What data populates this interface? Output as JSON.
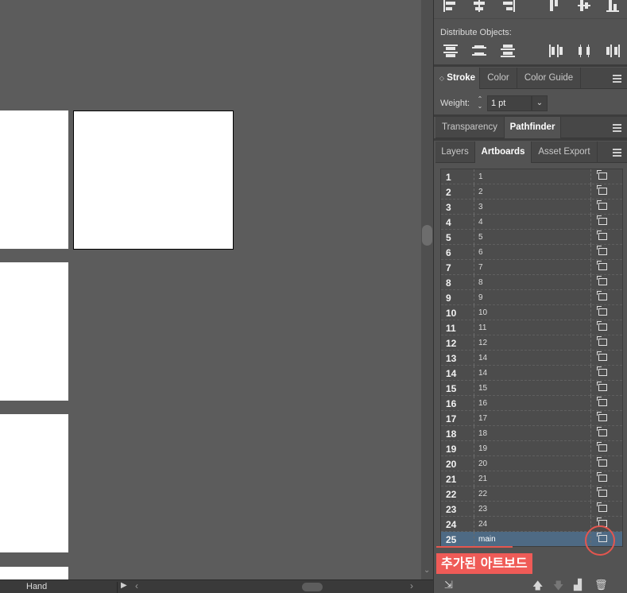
{
  "canvas": {
    "artboards": [
      "partial-1",
      "selected",
      "partial-2",
      "partial-3",
      "partial-4"
    ]
  },
  "status_bar": {
    "tool": "Hand",
    "play_icon": "play-icon",
    "left_arrow": "‹",
    "right_arrow": "›"
  },
  "panel": {
    "align_icons": [
      "align-left-icon",
      "align-hcenter-icon",
      "align-right-icon",
      "align-top-icon",
      "align-vcenter-icon",
      "align-bottom-icon"
    ],
    "distribute": {
      "label": "Distribute Objects:",
      "icons": [
        "distribute-top-icon",
        "distribute-vcenter-icon",
        "distribute-bottom-icon",
        "distribute-left-icon",
        "distribute-hcenter-icon",
        "distribute-right-icon"
      ]
    },
    "stroke_tabs": [
      "Stroke",
      "Color",
      "Color Guide"
    ],
    "stroke_tab_prefix": "◇",
    "weight": {
      "label": "Weight:",
      "value": "1 pt"
    },
    "transparency_tabs": [
      "Transparency",
      "Pathfinder"
    ],
    "artboard_tabs": [
      "Layers",
      "Artboards",
      "Asset Export"
    ],
    "artboards": [
      {
        "num": "1",
        "name": "1"
      },
      {
        "num": "2",
        "name": "2"
      },
      {
        "num": "3",
        "name": "3"
      },
      {
        "num": "4",
        "name": "4"
      },
      {
        "num": "5",
        "name": "5"
      },
      {
        "num": "6",
        "name": "6"
      },
      {
        "num": "7",
        "name": "7"
      },
      {
        "num": "8",
        "name": "8"
      },
      {
        "num": "9",
        "name": "9"
      },
      {
        "num": "10",
        "name": "10"
      },
      {
        "num": "11",
        "name": "11"
      },
      {
        "num": "12",
        "name": "12"
      },
      {
        "num": "13",
        "name": "14"
      },
      {
        "num": "14",
        "name": "14"
      },
      {
        "num": "15",
        "name": "15"
      },
      {
        "num": "16",
        "name": "16"
      },
      {
        "num": "17",
        "name": "17"
      },
      {
        "num": "18",
        "name": "18"
      },
      {
        "num": "19",
        "name": "19"
      },
      {
        "num": "20",
        "name": "20"
      },
      {
        "num": "21",
        "name": "21"
      },
      {
        "num": "22",
        "name": "22"
      },
      {
        "num": "23",
        "name": "23"
      },
      {
        "num": "24",
        "name": "24"
      },
      {
        "num": "25",
        "name": "main"
      }
    ],
    "selected_index": 24,
    "callout": "추가된 아트보드",
    "bottom_icons": [
      "rearrange-icon",
      "move-up-icon",
      "move-down-icon",
      "new-artboard-icon",
      "trash-icon"
    ],
    "highlight_color": "#e4564f",
    "selected_row_color": "#4e6a84"
  }
}
